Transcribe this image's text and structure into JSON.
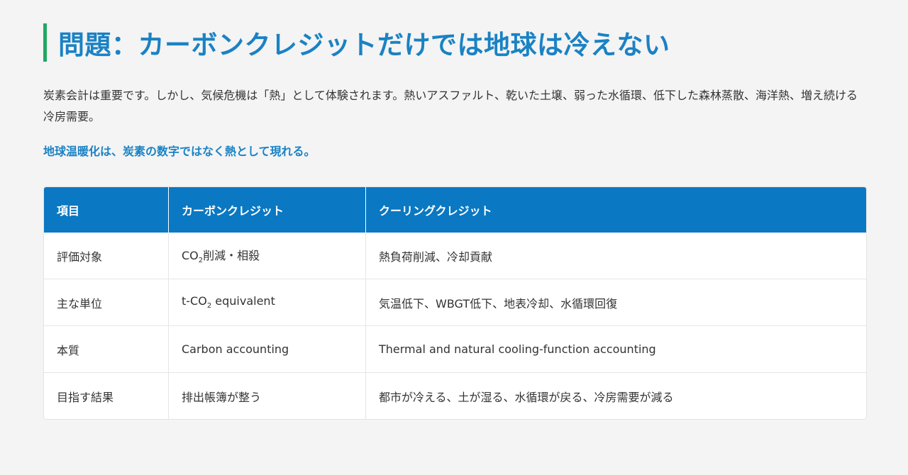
{
  "title": "問題：カーボンクレジットだけでは地球は冷えない",
  "intro": "炭素会計は重要です。しかし、気候危機は「熱」として体験されます。熱いアスファルト、乾いた土壌、弱った水循環、低下した森林蒸散、海洋熱、増え続ける冷房需要。",
  "highlight": "地球温暖化は、炭素の数字ではなく熱として現れる。",
  "colors": {
    "accent_bar": "#22a862",
    "title": "#1a82c4",
    "table_header": "#0a78c2"
  },
  "table": {
    "headers": [
      "項目",
      "カーボンクレジット",
      "クーリングクレジット"
    ],
    "rows": [
      {
        "item": "評価対象",
        "carbon_pre": "CO",
        "carbon_sub": "2",
        "carbon_post": "削減・相殺",
        "cooling": "熱負荷削減、冷却貢献"
      },
      {
        "item": "主な単位",
        "carbon_pre": "t-CO",
        "carbon_sub": "2",
        "carbon_post": " equivalent",
        "cooling": "気温低下、WBGT低下、地表冷却、水循環回復"
      },
      {
        "item": "本質",
        "carbon_pre": "Carbon accounting",
        "cooling": "Thermal and natural cooling-function accounting"
      },
      {
        "item": "目指す結果",
        "carbon_pre": "排出帳簿が整う",
        "cooling": "都市が冷える、土が湿る、水循環が戻る、冷房需要が減る"
      }
    ]
  }
}
